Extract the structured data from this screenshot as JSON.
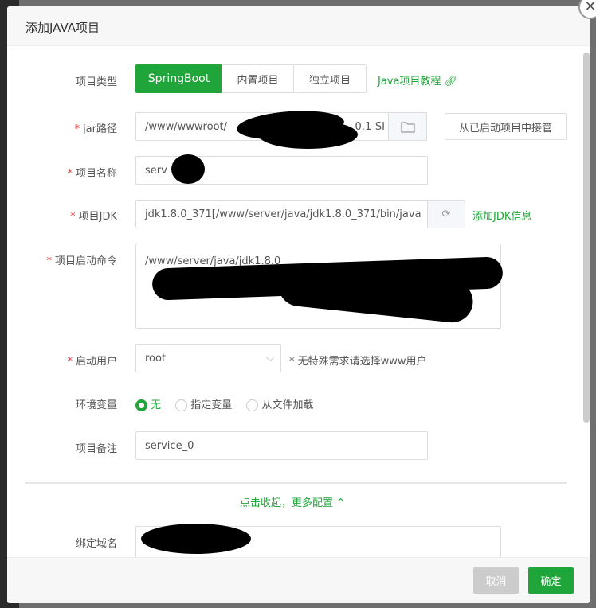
{
  "dialog": {
    "title": "添加JAVA项目",
    "close_icon": "close-icon"
  },
  "form": {
    "type": {
      "label": "项目类型",
      "options": [
        "SpringBoot",
        "内置项目",
        "独立项目"
      ],
      "selected": "SpringBoot",
      "tutorial_link": "Java项目教程"
    },
    "jar": {
      "label": "jar路径",
      "value_prefix": "/www/wwwroot/",
      "value_suffix": "0.1-SI",
      "takeover_button": "从已启动项目中接管"
    },
    "name": {
      "label": "项目名称",
      "value": "serv"
    },
    "jdk": {
      "label": "项目JDK",
      "value": "jdk1.8.0_371[/www/server/java/jdk1.8.0_371/bin/java",
      "add_link": "添加JDK信息"
    },
    "command": {
      "label": "项目启动命令",
      "value": "/www/server/java/jdk1.8.0"
    },
    "user": {
      "label": "启动用户",
      "value": "root",
      "hint": "* 无特殊需求请选择www用户"
    },
    "env": {
      "label": "环境变量",
      "options": [
        "无",
        "指定变量",
        "从文件加载"
      ],
      "selected": "无"
    },
    "remark": {
      "label": "项目备注",
      "value": "service_0"
    },
    "toggle": "点击收起，更多配置",
    "domain": {
      "label": "绑定域名"
    }
  },
  "footer": {
    "cancel": "取消",
    "confirm": "确定"
  },
  "colors": {
    "accent": "#20a53a",
    "required": "#e33333"
  }
}
